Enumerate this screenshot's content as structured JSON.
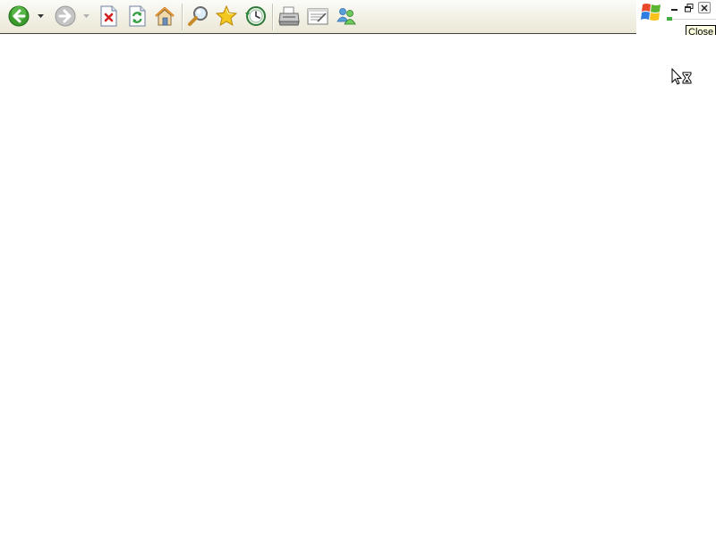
{
  "toolbar": {
    "buttons": [
      {
        "name": "back",
        "icon": "back-arrow-icon",
        "color": "#3a9a2c"
      },
      {
        "name": "forward",
        "icon": "forward-arrow-icon",
        "color": "#b8b8b8"
      },
      {
        "name": "stop",
        "icon": "stop-icon",
        "color": "#d42020"
      },
      {
        "name": "refresh",
        "icon": "refresh-icon",
        "color": "#2f9a3a"
      },
      {
        "name": "home",
        "icon": "home-icon",
        "color": "#e8a23c"
      },
      {
        "name": "search",
        "icon": "search-icon"
      },
      {
        "name": "favorites",
        "icon": "star-icon",
        "color": "#f2c81e"
      },
      {
        "name": "history",
        "icon": "history-icon",
        "color": "#2f8a3a"
      },
      {
        "name": "print",
        "icon": "printer-icon"
      },
      {
        "name": "edit",
        "icon": "edit-page-icon"
      },
      {
        "name": "messenger",
        "icon": "messenger-icon",
        "color": "#3a9a2c"
      }
    ]
  },
  "window_controls": {
    "logo": "windows-flag-icon",
    "minimize": "minimize-icon",
    "restore": "restore-icon",
    "close": "close-icon"
  },
  "tooltip": {
    "text": "Close"
  },
  "cursor": {
    "icon": "busy-cursor-icon"
  }
}
